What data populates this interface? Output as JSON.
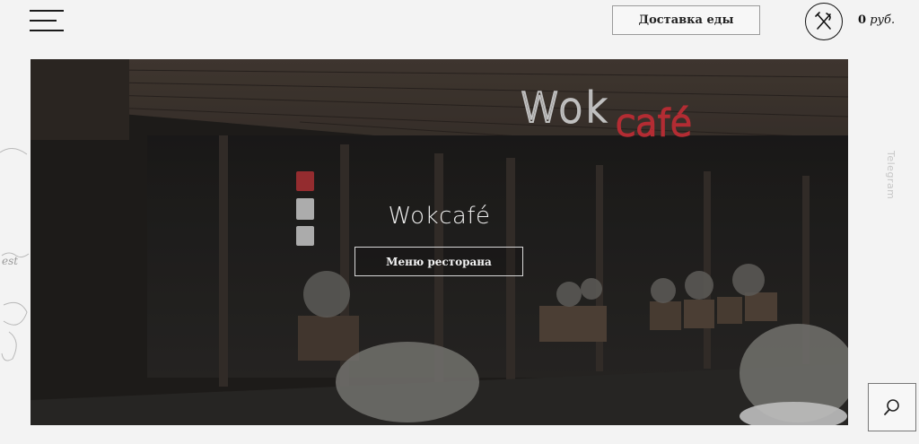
{
  "header": {
    "delivery_label": "Доставка еды",
    "cart_amount": "0",
    "cart_currency": "руб.",
    "menu_icon": "hamburger-menu-icon",
    "cart_icon": "fork-knife-icon"
  },
  "hero": {
    "title": "Wokcafé",
    "menu_button_label": "Меню ресторана",
    "sign_text_left": "Wok",
    "sign_text_right": "café"
  },
  "side": {
    "telegram_label": "Telegram",
    "search_icon": "search-icon"
  },
  "colors": {
    "page_bg": "#f3f3f3",
    "hero_dark": "#2a2623",
    "neon_red": "#d8343c",
    "neon_white": "#e8e8e8"
  }
}
